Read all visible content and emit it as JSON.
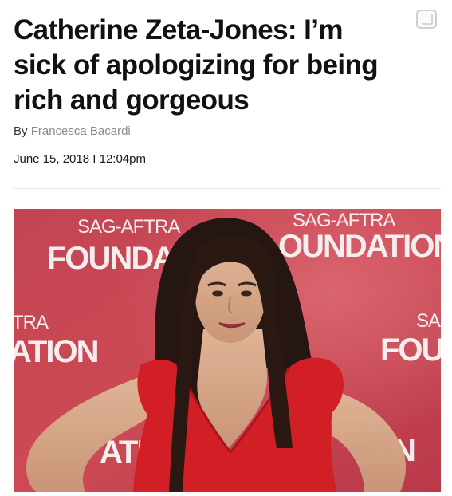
{
  "article": {
    "headline_lines": [
      "Catherine Zeta-Jones: I’m",
      "sick of apologizing for being",
      "rich and gorgeous"
    ],
    "byline_prefix": "By",
    "author": "Francesca Bacardi",
    "date": "June 15, 2018",
    "separator": "I",
    "time": "12:04pm"
  },
  "backdrop": {
    "texts": [
      "SAG-AFTRA",
      "FOUNDATION",
      "SAG-AFTRA",
      "OUNDATION",
      "TRA",
      "ATION",
      "SAG",
      "FOUN",
      "F",
      "ATI",
      "N"
    ]
  },
  "colors": {
    "backdrop": "#c8434f",
    "dress": "#d32227",
    "hair": "#2a1a16",
    "skin": "#d6a98a"
  },
  "icons": [
    "bookmark-icon"
  ]
}
